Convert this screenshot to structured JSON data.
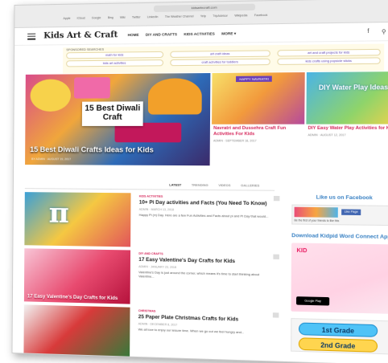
{
  "browser": {
    "url": "kidsartncraft.com",
    "bookmarks": [
      "Apple",
      "iCloud",
      "Google",
      "Bing",
      "Wiki",
      "Twitter",
      "LinkedIn",
      "The Weather Channel",
      "Yelp",
      "TripAdvisor",
      "Wikipedia",
      "Facebook"
    ]
  },
  "header": {
    "logo": "Kids Art & Craft",
    "nav": [
      "HOME",
      "DIY AND CRAFTS",
      "KIDS ACTIVITIES",
      "MORE ▾"
    ],
    "icons": [
      "facebook-icon",
      "search-icon"
    ]
  },
  "sponsored": {
    "label": "SPONSORED SEARCHES",
    "links": [
      "math for kids",
      "art craft ideas",
      "art and craft projects for kids",
      "kids art activities",
      "craft activities for toddlers",
      "kids crafts using popsicle sticks"
    ]
  },
  "hero": {
    "main_badge": "15 Best Diwali Craft",
    "main_title": "15 Best Diwali Crafts Ideas for Kids",
    "main_meta": "BY ADMIN  ·  AUGUST 19, 2017",
    "cards": [
      {
        "banner": "HAPPY NAVRATRI",
        "title": "Navratri and Dussehra Craft Fun Activities For Kids",
        "meta": "ADMIN  ·  SEPTEMBER 18, 2017"
      },
      {
        "image_text": "DIY Water Play Ideas",
        "title": "DIY Easy Water Play Activities for Kids",
        "meta": "ADMIN  ·  AUGUST 12, 2017"
      }
    ]
  },
  "tabs": [
    "LATEST",
    "TRENDING",
    "VIDEOS",
    "GALLERIES"
  ],
  "articles": [
    {
      "category": "KIDS ACTIVITIES",
      "title": "10+ Pi Day activities and Facts (You Need To Know)",
      "meta": "ADMIN  ·  MARCH 13, 2018",
      "excerpt": "Happy Pi (π) Day. Here are a few Fun Activities and Facts about pi and Pi Day that would..."
    },
    {
      "category": "DIY AND CRAFTS",
      "title": "17 Easy Valentine's Day Crafts for Kids",
      "meta": "ADMIN  ·  JANUARY 23, 2018",
      "excerpt": "Valentine's Day is just around the corner, which means it's time to start thinking about Valentine...",
      "image_text": "17 Easy Valentine's Day Crafts for Kids"
    },
    {
      "category": "CHRISTMAS",
      "title": "25 Paper Plate Christmas Crafts for Kids",
      "meta": "ADMIN  ·  DECEMBER 8, 2017",
      "excerpt": "We all love to enjoy our leisure time. When we go out we feel hungry and..."
    }
  ],
  "sidebar": {
    "facebook_title": "Like us on Facebook",
    "facebook_like": "Like Page",
    "facebook_text": "Be the first of your friends to like this",
    "app_title": "Download Kidpid Word Connect App",
    "app_logo": "KID",
    "google_play": "Google Play",
    "grades": [
      "1st Grade",
      "2nd Grade"
    ]
  }
}
